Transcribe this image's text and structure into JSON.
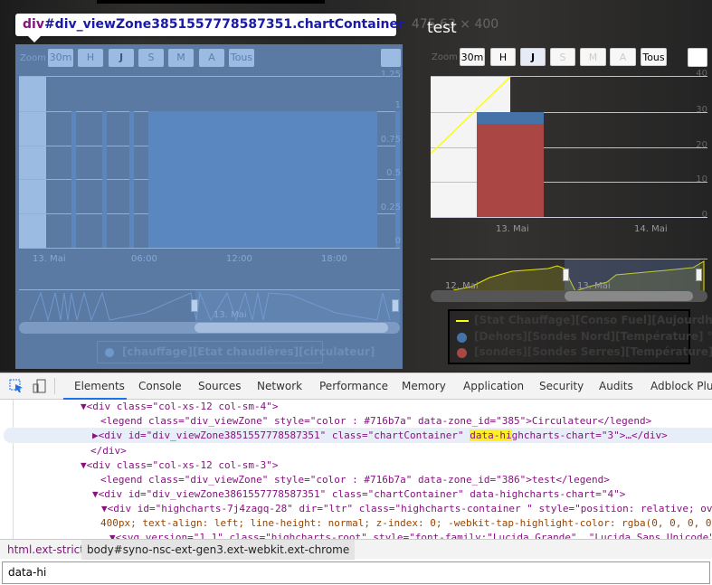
{
  "inspect_tooltip": {
    "tag": "div",
    "id": "#div_viewZone3851557778587351.chartContainer",
    "size": "475.63 × 400"
  },
  "left_chart": {
    "zoom_label": "Zoom",
    "buttons": [
      "30m",
      "H",
      "J",
      "S",
      "M",
      "A",
      "Tous"
    ],
    "y_ticks": [
      "1.25",
      "1",
      "0.75",
      "0.5",
      "0.25",
      "0"
    ],
    "x_ticks": [
      "13. Mai",
      "06:00",
      "12:00",
      "18:00"
    ],
    "navigator_label": "13. Mai",
    "legend": [
      "[chauffage][Etat chaudières][circulateur]"
    ]
  },
  "right_chart": {
    "title": "test",
    "zoom_label": "Zoom",
    "buttons": [
      "30m",
      "H",
      "J",
      "S",
      "M",
      "A",
      "Tous"
    ],
    "selected": "J",
    "y_ticks": [
      "40",
      "30",
      "20",
      "10",
      "0"
    ],
    "x_ticks": [
      "13. Mai",
      "14. Mai"
    ],
    "navigator_labels": [
      "12. Mai",
      "13. Mai"
    ],
    "legend": [
      {
        "label": "[Stat Chauffage][Conso Fuel][Aujourdhui] L",
        "color": "#ffff00",
        "symbol": "line"
      },
      {
        "label": "[Dehors][Sondes Nord][Température] °C",
        "color": "#4572a7",
        "symbol": "circle"
      },
      {
        "label": "[sondes][Sondes Serres][Température] °C",
        "color": "#aa4643",
        "symbol": "circle"
      }
    ],
    "columns": {
      "red": 26,
      "blue": 29
    }
  },
  "devtools": {
    "tabs": [
      "Elements",
      "Console",
      "Sources",
      "Network",
      "Performance",
      "Memory",
      "Application",
      "Security",
      "Audits",
      "Adblock Plus"
    ],
    "active_tab": "Elements",
    "breadcrumbs": [
      "html.ext-strict",
      "body#syno-nsc-ext-gen3.ext-webkit.ext-chrome"
    ],
    "search_value": "data-hi",
    "lines": [
      "▼<div class=\"col-xs-12 col-sm-4\">",
      "<legend class=\"div_viewZone\" style=\"color : #716b7a\" data-zone_id=\"385\">Circulateur</legend>",
      "▶<div id=\"div_viewZone3851557778587351\" class=\"chartContainer\" data-highcharts-chart=\"3\">…</div>",
      "</div>",
      "▼<div class=\"col-xs-12 col-sm-3\">",
      "<legend class=\"div_viewZone\" style=\"color : #716b7a\" data-zone_id=\"386\">test</legend>",
      "▼<div id=\"div_viewZone3861557778587351\" class=\"chartContainer\" data-highcharts-chart=\"4\">",
      "▼<div id=\"highcharts-7j4zagq-28\" dir=\"ltr\" class=\"highcharts-container \" style=\"position: relative; overflow: hidden; width:",
      "400px; text-align: left; line-height: normal; z-index: 0; -webkit-tap-highlight-color: rgba(0, 0, 0, 0);",
      "▼<svg version=\"1.1\" class=\"highcharts-root\" style=\"font-family:\"Lucida Grande\", \"Lucida Sans Unicode\""
    ]
  }
}
